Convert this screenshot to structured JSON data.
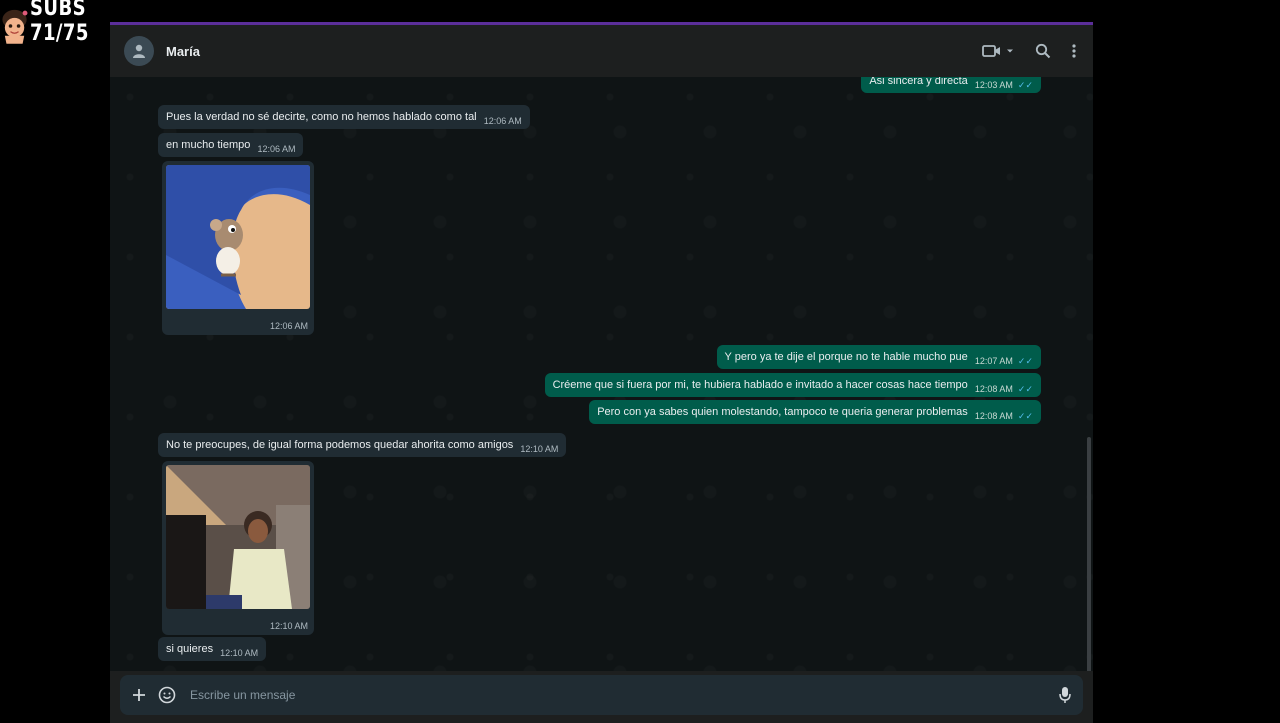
{
  "overlay": {
    "subs_text": "SUBS 71/75",
    "icon": "streamer-avatar-icon"
  },
  "header": {
    "contact_name": "María",
    "icons": [
      "default-avatar-icon",
      "video-call-icon",
      "chevron-down-icon",
      "search-icon",
      "more-vert-icon"
    ]
  },
  "messages": [
    {
      "dir": "out",
      "text": "Asi sincera y directa",
      "time": "12:03 AM"
    },
    {
      "dir": "in",
      "text": "Pues la verdad no sé decirte, como no hemos hablado como tal",
      "time": "12:06 AM"
    },
    {
      "dir": "in",
      "text": "en mucho tiempo",
      "time": "12:06 AM"
    },
    {
      "dir": "in",
      "media": "cartoon-mouse-sticker",
      "time": "12:06 AM"
    },
    {
      "dir": "out",
      "text": "Y pero ya te dije el porque no te hable mucho pue",
      "time": "12:07 AM"
    },
    {
      "dir": "out",
      "text": "Créeme que si fuera por mi, te hubiera hablado e invitado a hacer cosas hace tiempo",
      "time": "12:08 AM"
    },
    {
      "dir": "out",
      "text": "Pero con ya sabes quien molestando, tampoco te queria generar problemas",
      "time": "12:08 AM"
    },
    {
      "dir": "in",
      "text": "No te preocupes, de igual forma podemos quedar ahorita como amigos",
      "time": "12:10 AM"
    },
    {
      "dir": "in",
      "media": "person-photo",
      "time": "12:10 AM"
    },
    {
      "dir": "in",
      "text": "si quieres",
      "time": "12:10 AM"
    }
  ],
  "composer": {
    "placeholder": "Escribe un mensaje",
    "icons": [
      "plus-icon",
      "sticker-icon",
      "mic-icon"
    ]
  },
  "colors": {
    "incoming": "#202c33",
    "outgoing": "#005c4b",
    "read_ticks": "#53bdeb",
    "accent_bar": "#5b2e9a"
  }
}
